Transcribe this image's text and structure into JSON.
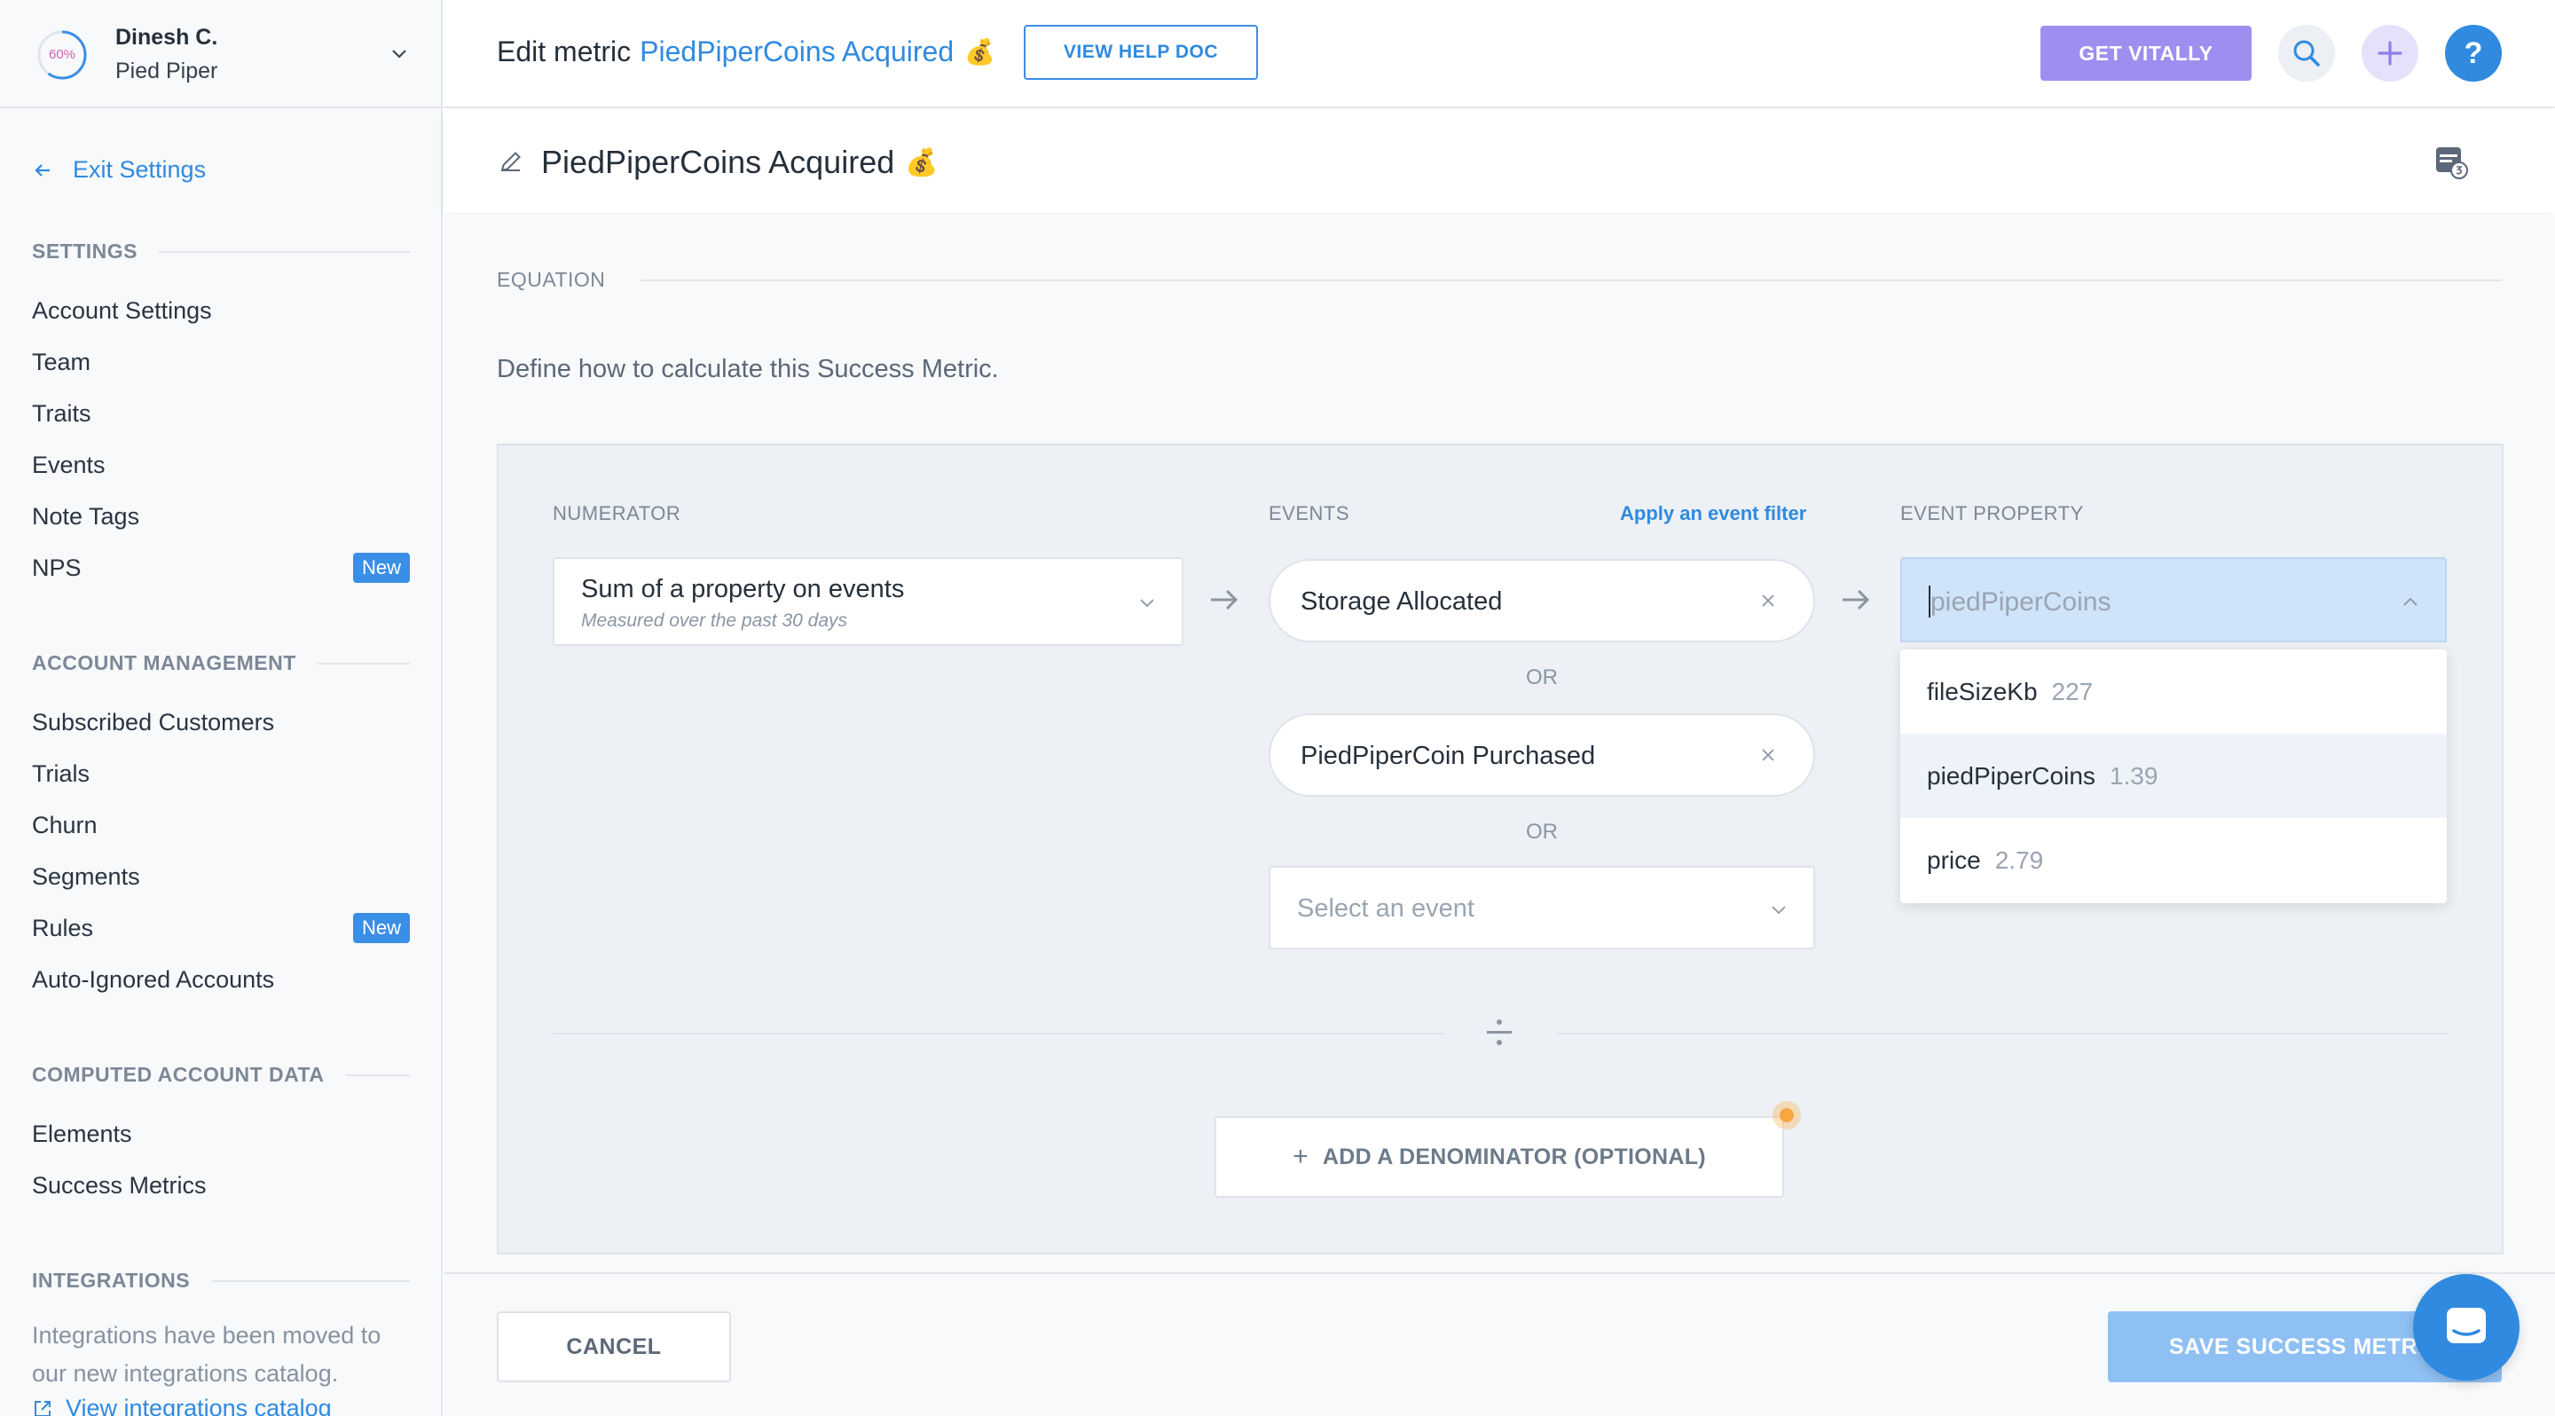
{
  "sidebar": {
    "progress_text": "60%",
    "user_name": "Dinesh C.",
    "org_name": "Pied Piper",
    "exit_label": "Exit Settings",
    "sections": {
      "settings": "SETTINGS",
      "account_management": "ACCOUNT MANAGEMENT",
      "computed": "COMPUTED ACCOUNT DATA",
      "integrations": "INTEGRATIONS"
    },
    "settings_items": [
      {
        "label": "Account Settings"
      },
      {
        "label": "Team"
      },
      {
        "label": "Traits"
      },
      {
        "label": "Events"
      },
      {
        "label": "Note Tags"
      },
      {
        "label": "NPS",
        "badge": "New"
      }
    ],
    "account_items": [
      {
        "label": "Subscribed Customers"
      },
      {
        "label": "Trials"
      },
      {
        "label": "Churn"
      },
      {
        "label": "Segments"
      },
      {
        "label": "Rules",
        "badge": "New"
      },
      {
        "label": "Auto-Ignored Accounts"
      }
    ],
    "computed_items": [
      {
        "label": "Elements"
      },
      {
        "label": "Success Metrics"
      }
    ],
    "integrations_note": "Integrations have been moved to our new integrations catalog.",
    "integrations_link": "View integrations catalog"
  },
  "topbar": {
    "title_prefix": "Edit metric",
    "metric_name": "PiedPiperCoins Acquired",
    "emoji": "💰",
    "help_doc_label": "VIEW HELP DOC",
    "get_vitally_label": "GET VITALLY",
    "help_label": "?"
  },
  "namebar": {
    "metric_name": "PiedPiperCoins Acquired",
    "emoji": "💰"
  },
  "equation": {
    "heading": "EQUATION",
    "description": "Define how to calculate this Success Metric.",
    "numerator_label": "NUMERATOR",
    "events_label": "EVENTS",
    "apply_filter_label": "Apply an event filter",
    "event_property_label": "EVENT PROPERTY",
    "numerator_value": "Sum of a property on events",
    "numerator_sub": "Measured over the past 30 days",
    "events": [
      "Storage Allocated",
      "PiedPiperCoin Purchased"
    ],
    "or_label": "OR",
    "event_placeholder": "Select an event",
    "property_value": "piedPiperCoins",
    "property_options": [
      {
        "name": "fileSizeKb",
        "value": "227"
      },
      {
        "name": "piedPiperCoins",
        "value": "1.39"
      },
      {
        "name": "price",
        "value": "2.79"
      }
    ],
    "add_denominator_label": "ADD A DENOMINATOR (OPTIONAL)"
  },
  "footer": {
    "cancel_label": "CANCEL",
    "save_label": "SAVE SUCCESS METRIC"
  },
  "colors": {
    "accent": "#2f8ae0",
    "vitally_purple": "#9c8ff0",
    "new_badge": "#3a8ee6"
  }
}
